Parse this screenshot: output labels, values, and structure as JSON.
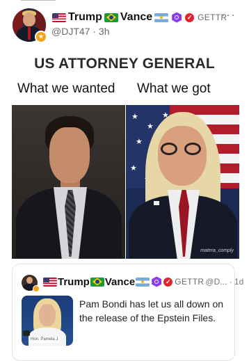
{
  "post": {
    "author": {
      "name_part1": "Trump",
      "name_part2": "Vance",
      "platform": "GETTR",
      "handle": "@DJT47",
      "time": "3h"
    },
    "more_label": "···",
    "meme": {
      "title": "US ATTORNEY GENERAL",
      "caption_left": "What we wanted",
      "caption_right": "What we got",
      "watermark": "matera_comply"
    },
    "quoted": {
      "author": {
        "name_part1": "Trump",
        "name_part2": "Vance",
        "platform": "GETTR",
        "handle": "@D...",
        "time": "1d"
      },
      "thumbnail_caption": "Hon. Pamela J",
      "text": "Pam Bondi has let us all down on the release of the Epstein Files."
    }
  },
  "colors": {
    "verified_badge": "#e0232f",
    "hex_badge": "#8b3be8",
    "gold_badge": "#f4a41c"
  }
}
